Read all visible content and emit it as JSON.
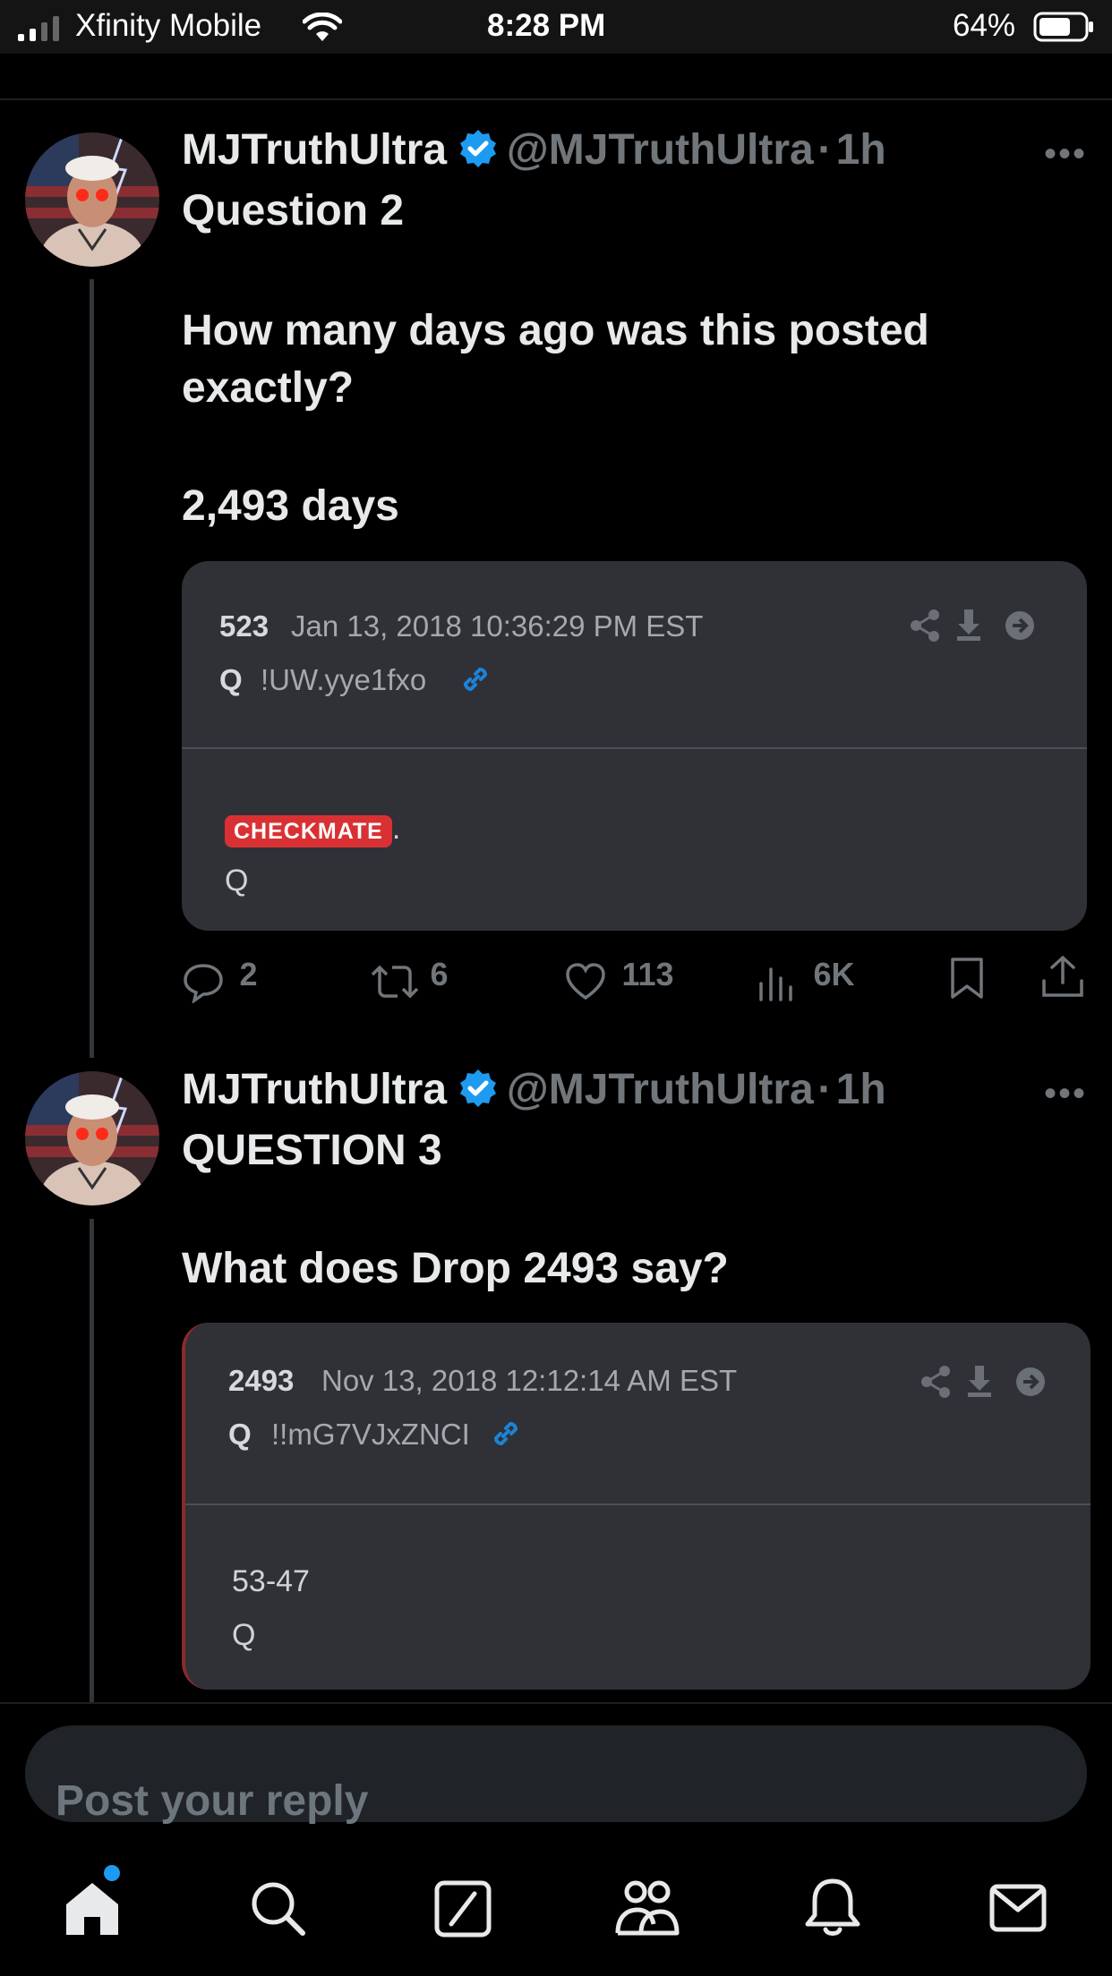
{
  "status_bar": {
    "carrier": "Xfinity Mobile",
    "time": "8:28 PM",
    "battery": "64%"
  },
  "tweets": [
    {
      "name": "MJTruthUltra",
      "handle": "@MJTruthUltra",
      "dot": "·",
      "age": "1h",
      "lines": [
        "Question 2",
        "How many days ago was this posted",
        "exactly?",
        "2,493 days"
      ],
      "card": {
        "number": "523",
        "date": "Jan 13, 2018 10:36:29 PM EST",
        "q": "Q",
        "tripcode": "!UW.yye1fxo",
        "badge": "CHECKMATE",
        "badge_suffix": ".",
        "body_lines": [
          "Q"
        ]
      },
      "actions": {
        "replies": "2",
        "reposts": "6",
        "likes": "113",
        "views": "6K"
      }
    },
    {
      "name": "MJTruthUltra",
      "handle": "@MJTruthUltra",
      "dot": "·",
      "age": "1h",
      "lines": [
        "QUESTION 3",
        "What does Drop 2493 say?"
      ],
      "card": {
        "number": "2493",
        "date": "Nov 13, 2018 12:12:14 AM EST",
        "q": "Q",
        "tripcode": "!!mG7VJxZNCI",
        "body_lines": [
          "53-47",
          "Q"
        ]
      }
    }
  ],
  "reply_placeholder": "Post your reply",
  "colors": {
    "accent": "#1d9bf0",
    "badge": "#d93133"
  }
}
